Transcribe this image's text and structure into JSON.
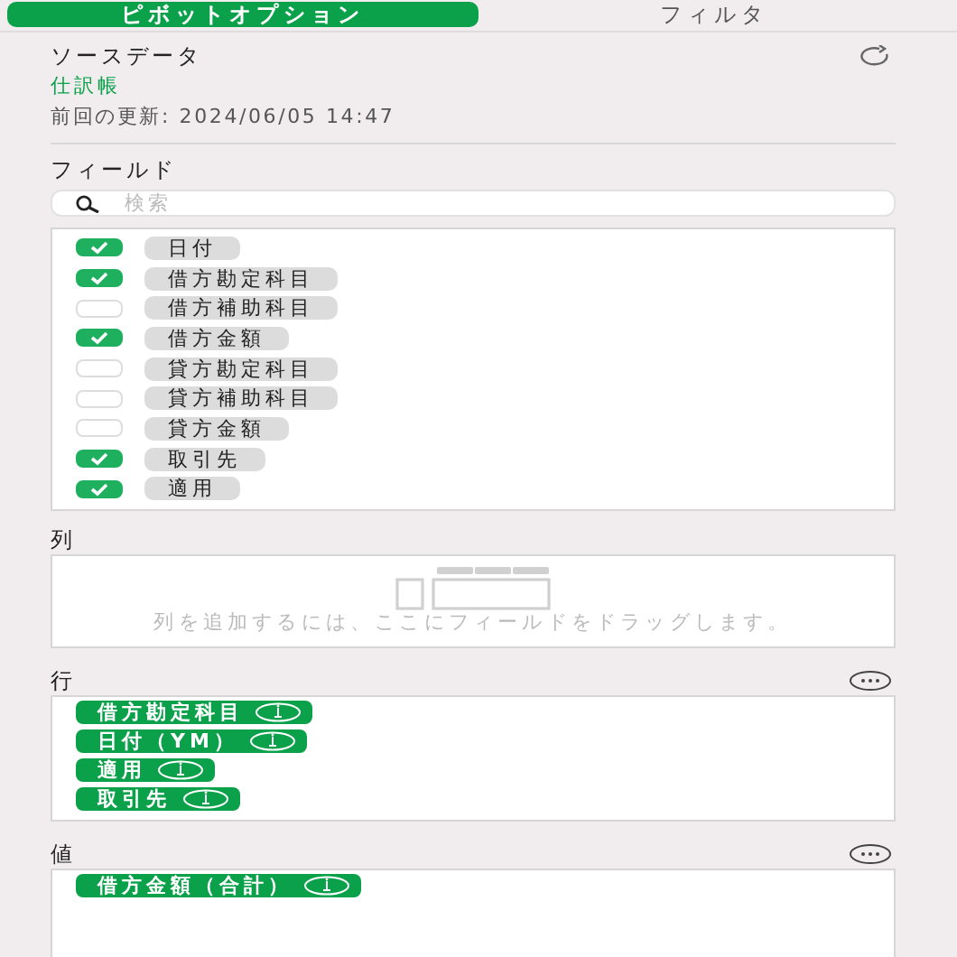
{
  "tabs": [
    {
      "label": "ピボットオプション",
      "selected": true
    },
    {
      "label": "フィルタ",
      "selected": false
    }
  ],
  "source": {
    "title": "ソースデータ",
    "name": "仕訳帳",
    "updated": "前回の更新: 2024/06/05 14:47"
  },
  "fields": {
    "title": "フィールド",
    "search": {
      "placeholder": "検索"
    },
    "items": [
      {
        "label": "日付",
        "checked": true
      },
      {
        "label": "借方勘定科目",
        "checked": true
      },
      {
        "label": "借方補助科目",
        "checked": false
      },
      {
        "label": "借方金額",
        "checked": true
      },
      {
        "label": "貸方勘定科目",
        "checked": false
      },
      {
        "label": "貸方補助科目",
        "checked": false
      },
      {
        "label": "貸方金額",
        "checked": false
      },
      {
        "label": "取引先",
        "checked": true
      },
      {
        "label": "適用",
        "checked": true
      }
    ]
  },
  "columns": {
    "title": "列",
    "hint": "列を追加するには、ここにフィールドをドラッグします。"
  },
  "rows": {
    "title": "行",
    "items": [
      "借方勘定科目",
      "日付（YM）",
      "適用",
      "取引先"
    ]
  },
  "values": {
    "title": "値",
    "items": [
      "借方金額（合計）"
    ]
  }
}
